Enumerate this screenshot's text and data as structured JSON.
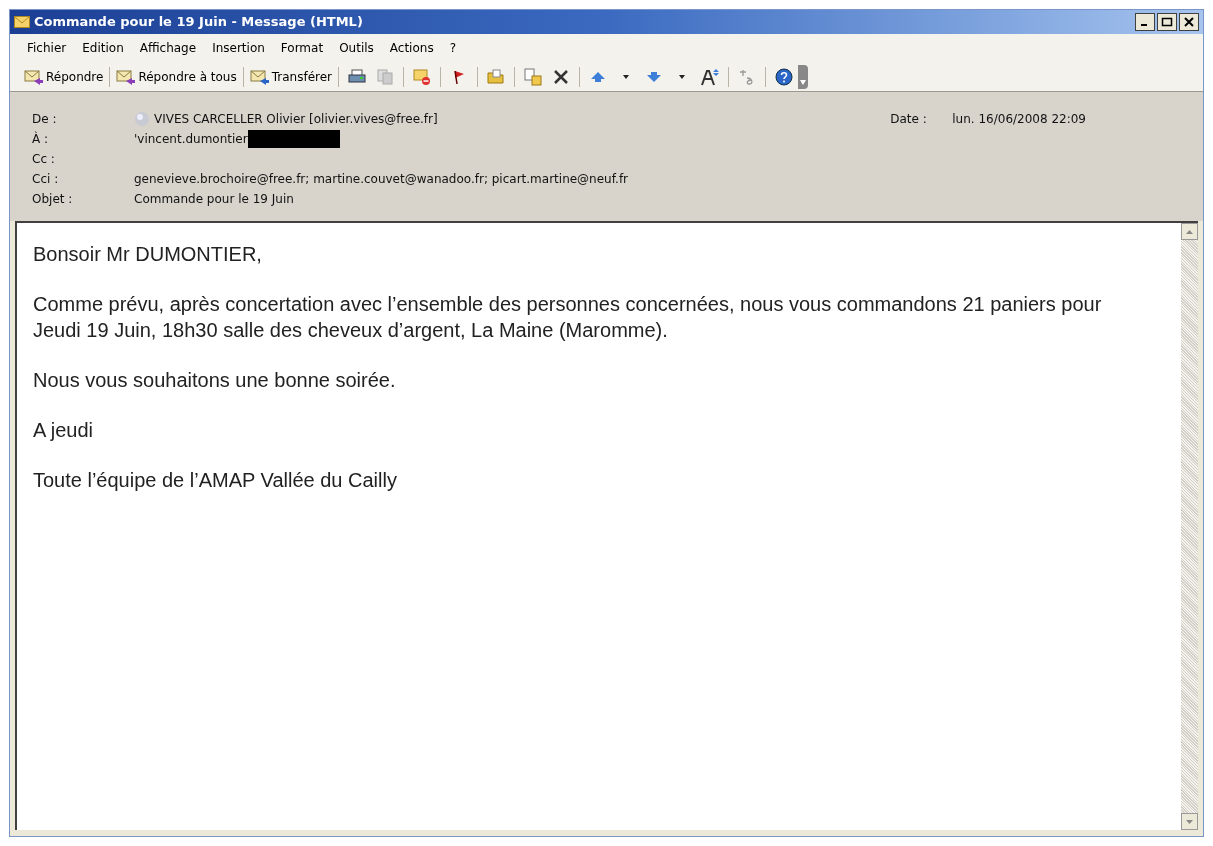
{
  "window": {
    "title": "Commande pour le 19 Juin - Message (HTML)"
  },
  "menu": [
    "Fichier",
    "Edition",
    "Affichage",
    "Insertion",
    "Format",
    "Outils",
    "Actions",
    "?"
  ],
  "toolbar": [
    {
      "label": "Répondre"
    },
    {
      "label": "Répondre à tous"
    },
    {
      "label": "Transférer"
    }
  ],
  "header": {
    "fields": [
      {
        "label": "De :",
        "value": "VIVES CARCELLER Olivier [olivier.vives@free.fr]",
        "kind": "sender"
      },
      {
        "label": "À :",
        "value": "'vincent.dumontier",
        "kind": "redacted"
      },
      {
        "label": "Cc :",
        "kind": "plain"
      },
      {
        "label": "Cci :",
        "value": "genevieve.brochoire@free.fr; martine.couvet@wanadoo.fr; picart.martine@neuf.fr",
        "kind": "plain"
      },
      {
        "label": "Objet :",
        "value": "Commande pour le 19 Juin",
        "kind": "plain"
      }
    ],
    "date": {
      "label": "Date :",
      "value": "lun. 16/06/2008 22:09"
    }
  },
  "body": [
    "Bonsoir Mr DUMONTIER,",
    "Comme prévu, après concertation avec l’ensemble des personnes concernées, nous vous commandons 21 paniers pour Jeudi 19 Juin, 18h30 salle des cheveux d’argent, La Maine (Maromme).",
    "Nous vous souhaitons une bonne soirée.",
    "A jeudi",
    "Toute l’équipe de l’AMAP Vallée du Cailly"
  ]
}
